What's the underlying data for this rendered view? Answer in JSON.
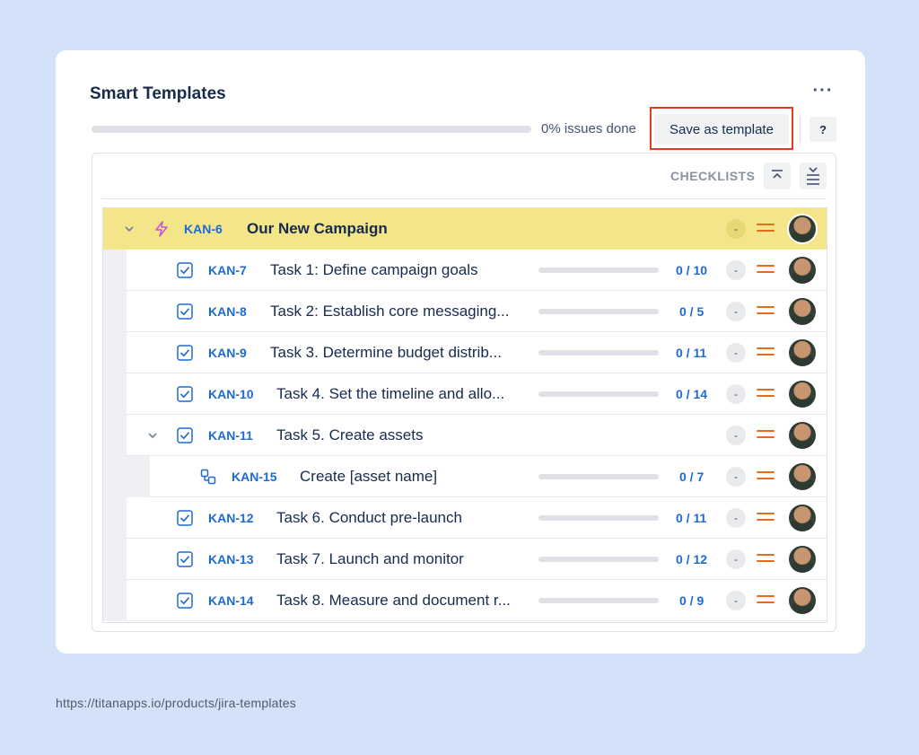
{
  "header": {
    "title": "Smart Templates",
    "more_label": "···",
    "progress_text": "0% issues done",
    "progress_fraction": 0,
    "save_label": "Save as template",
    "help_label": "?"
  },
  "panel": {
    "checklists_label": "CHECKLISTS"
  },
  "colors": {
    "background": "#d3e2f8",
    "parent_highlight": "#f4e58a",
    "key_blue": "#1d6ad6",
    "priority_orange": "#e86a1c",
    "annotation_red": "#e03c1f"
  },
  "parent": {
    "key": "KAN-6",
    "summary": "Our New Campaign",
    "status": "-",
    "icon": "lightning-icon"
  },
  "rows": [
    {
      "key": "KAN-7",
      "summary": "Task 1: Define campaign goals",
      "count": "0 / 10",
      "done_fraction": 0,
      "status": "-",
      "icon": "checkbox-icon"
    },
    {
      "key": "KAN-8",
      "summary": "Task 2: Establish core messaging...",
      "count": "0 / 5",
      "done_fraction": 0,
      "status": "-",
      "icon": "checkbox-icon"
    },
    {
      "key": "KAN-9",
      "summary": "Task 3. Determine budget distrib...",
      "count": "0 / 11",
      "done_fraction": 0,
      "status": "-",
      "icon": "checkbox-icon"
    },
    {
      "key": "KAN-10",
      "summary": "Task 4. Set the timeline and allo...",
      "count": "0 / 14",
      "done_fraction": 0,
      "status": "-",
      "icon": "checkbox-icon"
    },
    {
      "key": "KAN-11",
      "summary": "Task 5. Create assets",
      "count": "",
      "status": "-",
      "icon": "checkbox-icon",
      "expandable": true
    },
    {
      "key": "KAN-15",
      "summary": "Create [asset name]",
      "count": "0 / 7",
      "done_fraction": 0,
      "status": "-",
      "icon": "subtask-icon",
      "child": true
    },
    {
      "key": "KAN-12",
      "summary": "Task 6. Conduct pre-launch",
      "count": "0 / 11",
      "done_fraction": 0,
      "status": "-",
      "icon": "checkbox-icon"
    },
    {
      "key": "KAN-13",
      "summary": "Task 7. Launch and monitor",
      "count": "0 / 12",
      "done_fraction": 0,
      "status": "-",
      "icon": "checkbox-icon"
    },
    {
      "key": "KAN-14",
      "summary": "Task 8. Measure and document r...",
      "count": "0 / 9",
      "done_fraction": 0,
      "status": "-",
      "icon": "checkbox-icon"
    }
  ],
  "footer": {
    "url": "https://titanapps.io/products/jira-templates"
  }
}
